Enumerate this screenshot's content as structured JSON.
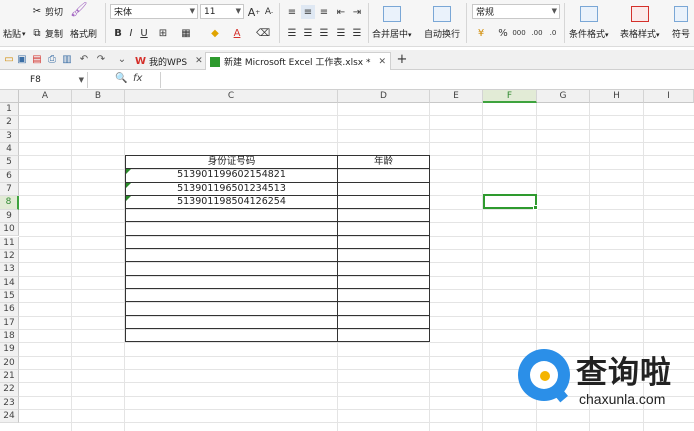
{
  "ribbon": {
    "paste_label": "粘贴",
    "cut_label": "剪切",
    "copy_label": "复制",
    "format_painter_label": "格式刷",
    "font_name": "宋体",
    "font_size": "11",
    "bold": "B",
    "italic": "I",
    "underline": "U",
    "merge_center_label": "合并居中",
    "wrap_label": "自动换行",
    "number_format": "常规",
    "percent": "%",
    "conditional_format_label": "条件格式",
    "table_style_label": "表格样式",
    "symbol_label": "符号",
    "font_color": "A",
    "increase_font": "A",
    "decrease_font": "A"
  },
  "tabs": [
    {
      "label": "我的WPS"
    },
    {
      "label": "新建 Microsoft Excel 工作表.xlsx *"
    }
  ],
  "formula_bar": {
    "cell_ref": "F8",
    "fx": "fx"
  },
  "columns": [
    "A",
    "B",
    "C",
    "D",
    "E",
    "F",
    "G",
    "H",
    "I"
  ],
  "rows": [
    "1",
    "2",
    "3",
    "4",
    "5",
    "6",
    "7",
    "8",
    "9",
    "10",
    "11",
    "12",
    "13",
    "14",
    "15",
    "16",
    "17",
    "18",
    "19",
    "20",
    "21",
    "22",
    "23",
    "24"
  ],
  "table": {
    "header": {
      "c": "身份证号码",
      "d": "年龄"
    },
    "data": [
      {
        "c": "513901199602154821",
        "d": ""
      },
      {
        "c": "513901196501234513",
        "d": ""
      },
      {
        "c": "513901198504126254",
        "d": ""
      }
    ]
  },
  "watermark": {
    "title": "查询啦",
    "url": "chaxunla.com"
  },
  "colors": {
    "accent_green": "#3ea33e",
    "wps_red": "#d4302b",
    "logo_blue": "#2b8fe8"
  }
}
